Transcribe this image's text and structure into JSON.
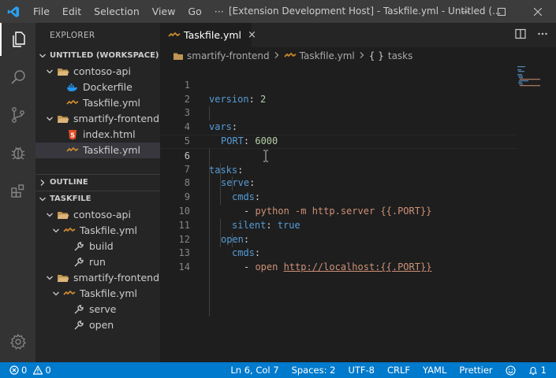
{
  "titlebar": {
    "menu": [
      "File",
      "Edit",
      "Selection",
      "View",
      "Go",
      "···"
    ],
    "window_title": "[Extension Development Host] - Taskfile.yml - Untitled (..."
  },
  "sidebar": {
    "title": "EXPLORER",
    "workspace_header": "UNTITLED (WORKSPACE)",
    "workspace_tree": [
      {
        "label": "contoso-api",
        "kind": "folder"
      },
      {
        "label": "Dockerfile",
        "kind": "docker"
      },
      {
        "label": "Taskfile.yml",
        "kind": "yaml"
      },
      {
        "label": "smartify-frontend",
        "kind": "folder"
      },
      {
        "label": "index.html",
        "kind": "html"
      },
      {
        "label": "Taskfile.yml",
        "kind": "yaml",
        "selected": true
      }
    ],
    "outline_header": "OUTLINE",
    "taskfile_header": "TASKFILE",
    "taskfile_tree": [
      {
        "label": "contoso-api",
        "kind": "folder"
      },
      {
        "label": "Taskfile.yml",
        "kind": "yaml"
      },
      {
        "label": "build",
        "kind": "task"
      },
      {
        "label": "run",
        "kind": "task"
      },
      {
        "label": "smartify-frontend",
        "kind": "folder"
      },
      {
        "label": "Taskfile.yml",
        "kind": "yaml"
      },
      {
        "label": "serve",
        "kind": "task"
      },
      {
        "label": "open",
        "kind": "task"
      }
    ]
  },
  "editor": {
    "tab_label": "Taskfile.yml",
    "tab_close": "×",
    "breadcrumb": [
      "smartify-frontend",
      "Taskfile.yml",
      "tasks"
    ],
    "breadcrumb_tasks_icon": "{ }",
    "current_line": 6,
    "line_numbers": [
      "1",
      "2",
      "3",
      "4",
      "5",
      "6",
      "7",
      "8",
      "9",
      "10",
      "11",
      "12",
      "13",
      "14"
    ],
    "code": {
      "l1_key": "version",
      "l1_val": "2",
      "l3_key": "vars",
      "l4_key": "PORT",
      "l4_val": "6000",
      "l6_key": "tasks",
      "l7_key": "serve",
      "l8_key": "cmds",
      "l9_val": "python -m http.server {{.PORT}}",
      "l10_key": "silent",
      "l10_val": "true",
      "l11_key": "open",
      "l12_key": "cmds",
      "l13_cmd": "open ",
      "l13_url": "http://localhost:{{.PORT}}"
    }
  },
  "statusbar": {
    "errors": "0",
    "warnings": "0",
    "position": "Ln 6, Col 7",
    "spaces": "Spaces: 2",
    "encoding": "UTF-8",
    "eol": "CRLF",
    "language": "YAML",
    "formatter": "Prettier",
    "notifications": "1"
  },
  "colors": {
    "accent": "#007acc",
    "titlebar": "#3c3c3c",
    "activitybar": "#333333",
    "sidebar": "#252526",
    "editor": "#1e1e1e",
    "yaml_icon": "#cb8a2e",
    "folder_icon": "#c09553"
  }
}
